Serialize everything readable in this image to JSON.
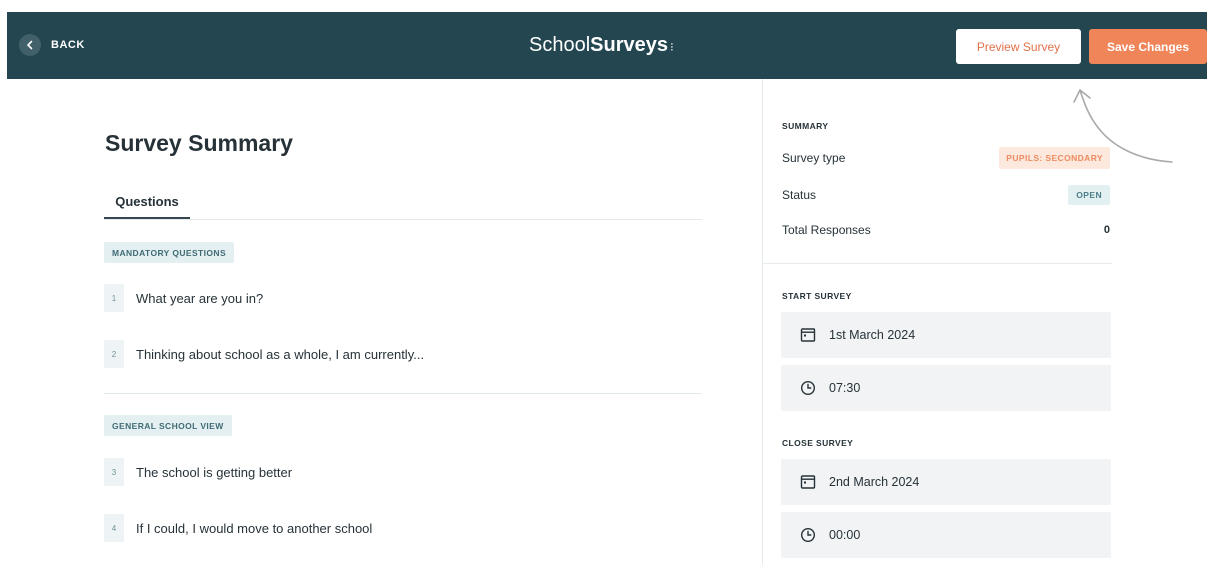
{
  "header": {
    "back_label": "BACK",
    "brand_light": "School",
    "brand_bold": "Surveys",
    "brand_mark": "⁝",
    "preview_label": "Preview Survey",
    "save_label": "Save Changes"
  },
  "main": {
    "title": "Survey Summary",
    "tabs": [
      {
        "label": "Questions"
      }
    ],
    "sections": [
      {
        "label": "MANDATORY QUESTIONS",
        "questions": [
          {
            "number": "1",
            "text": "What year are you in?"
          },
          {
            "number": "2",
            "text": "Thinking about school as a whole, I am currently..."
          }
        ]
      },
      {
        "label": "GENERAL SCHOOL VIEW",
        "questions": [
          {
            "number": "3",
            "text": "The school is getting better"
          },
          {
            "number": "4",
            "text": "If I could, I would move to another school"
          }
        ]
      }
    ]
  },
  "summary": {
    "heading": "SUMMARY",
    "survey_type_label": "Survey type",
    "survey_type_value": "PUPILS: SECONDARY",
    "status_label": "Status",
    "status_value": "OPEN",
    "responses_label": "Total Responses",
    "responses_value": "0"
  },
  "start_survey": {
    "heading": "START SURVEY",
    "date": "1st March 2024",
    "time": "07:30"
  },
  "close_survey": {
    "heading": "CLOSE SURVEY",
    "date": "2nd March 2024",
    "time": "00:00"
  },
  "icons": {
    "back": "chevron-left-icon",
    "calendar": "calendar-icon",
    "clock": "clock-icon",
    "annotation": "hand-drawn-arrow-icon"
  },
  "colors": {
    "header_bg": "#234650",
    "accent_orange": "#ef8559",
    "chip_bg": "#e3eff1"
  }
}
